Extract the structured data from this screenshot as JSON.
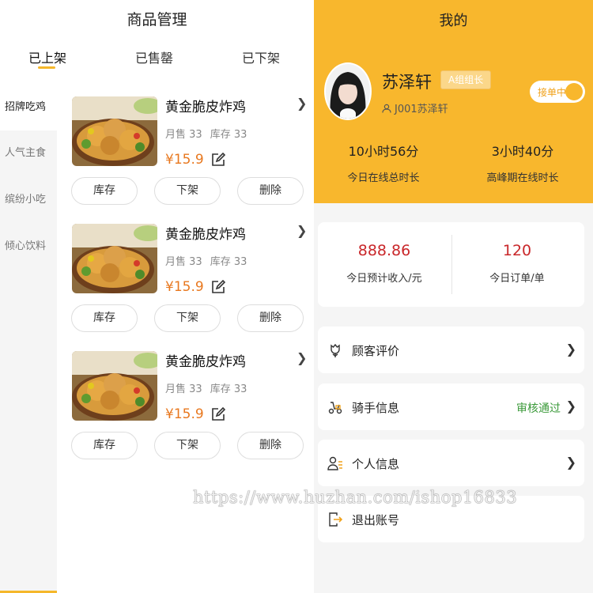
{
  "product_panel": {
    "title": "商品管理",
    "tabs": [
      {
        "label": "已上架",
        "active": true
      },
      {
        "label": "已售罄",
        "active": false
      },
      {
        "label": "已下架",
        "active": false
      }
    ],
    "categories": [
      {
        "label": "招牌吃鸡",
        "active": true
      },
      {
        "label": "人气主食",
        "active": false
      },
      {
        "label": "缤纷小吃",
        "active": false
      },
      {
        "label": "倾心饮料",
        "active": false
      }
    ],
    "products": [
      {
        "name": "黄金脆皮炸鸡",
        "sold": "月售 33",
        "stock": "库存 33",
        "price": "¥15.9",
        "actions": [
          "库存",
          "下架",
          "删除"
        ]
      },
      {
        "name": "黄金脆皮炸鸡",
        "sold": "月售 33",
        "stock": "库存 33",
        "price": "¥15.9",
        "actions": [
          "库存",
          "下架",
          "删除"
        ]
      },
      {
        "name": "黄金脆皮炸鸡",
        "sold": "月售 33",
        "stock": "库存 33",
        "price": "¥15.9",
        "actions": [
          "库存",
          "下架",
          "删除"
        ]
      }
    ]
  },
  "profile_panel": {
    "title": "我的",
    "user": {
      "name": "苏泽轩",
      "role_badge": "A组组长",
      "id_line": "J001苏泽轩"
    },
    "order_toggle": {
      "label": "接单中",
      "on": true
    },
    "stats": [
      {
        "value": "10小时56分",
        "label": "今日在线总时长"
      },
      {
        "value": "3小时40分",
        "label": "高峰期在线时长"
      }
    ],
    "income": [
      {
        "value": "888.86",
        "label": "今日预计收入/元"
      },
      {
        "value": "120",
        "label": "今日订单/单"
      }
    ],
    "menu": [
      {
        "label": "顾客评价",
        "icon": "flower-icon",
        "status": "",
        "arrow": true
      },
      {
        "label": "骑手信息",
        "icon": "scooter-icon",
        "status": "审核通过",
        "arrow": true
      },
      {
        "label": "个人信息",
        "icon": "user-list-icon",
        "status": "",
        "arrow": true
      },
      {
        "label": "退出账号",
        "icon": "logout-icon",
        "status": "",
        "arrow": false
      }
    ]
  },
  "watermark": "https://www.huzhan.com/ishop16833",
  "colors": {
    "accent": "#f8b72d",
    "price": "#e8781f",
    "income": "#c9272a",
    "approved": "#3b9a3a"
  }
}
